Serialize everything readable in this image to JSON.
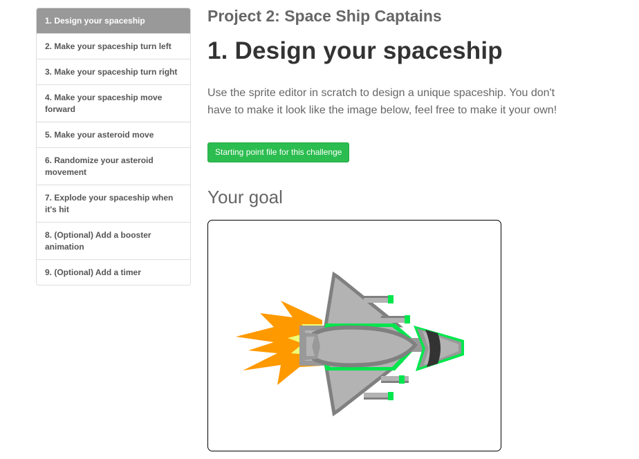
{
  "sidebar": {
    "items": [
      {
        "label": "1. Design your spaceship",
        "active": true
      },
      {
        "label": "2. Make your spaceship turn left",
        "active": false
      },
      {
        "label": "3. Make your spaceship turn right",
        "active": false
      },
      {
        "label": "4. Make your spaceship move forward",
        "active": false
      },
      {
        "label": "5. Make your asteroid move",
        "active": false
      },
      {
        "label": "6. Randomize your asteroid movement",
        "active": false
      },
      {
        "label": "7. Explode your spaceship when it's hit",
        "active": false
      },
      {
        "label": "8. (Optional) Add a booster animation",
        "active": false
      },
      {
        "label": "9. (Optional) Add a timer",
        "active": false
      }
    ]
  },
  "main": {
    "project_title": "Project 2: Space Ship Captains",
    "step_title": "1. Design your spaceship",
    "description": "Use the sprite editor in scratch to design a unique spaceship. You don't have to make it look like the image below, feel free to make it your own!",
    "start_button_label": "Starting point file for this challenge",
    "goal_heading": "Your goal",
    "goal_image": {
      "subject": "spaceship-sprite",
      "colors": {
        "hull": "#b3b3b3",
        "hull_outline": "#808080",
        "trim": "#00e64d",
        "flame_outer": "#ff9900",
        "flame_inner": "#eeff77",
        "cockpit_band": "#333333"
      }
    }
  },
  "theme": {
    "active_nav_bg": "#999999",
    "button_green": "#2bbd4f"
  }
}
